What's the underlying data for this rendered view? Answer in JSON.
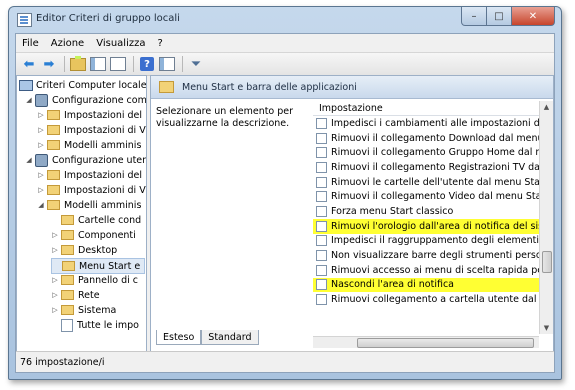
{
  "window": {
    "title": "Editor Criteri di gruppo locali",
    "minimize": "–",
    "maximize": "□",
    "close": "✕"
  },
  "menu": [
    "File",
    "Azione",
    "Visualizza",
    "?"
  ],
  "tree": [
    {
      "label": "Criteri Computer locale",
      "icon": "computer-icon",
      "level": 0,
      "toggle": ""
    },
    {
      "label": "Configurazione com",
      "icon": "config-icon",
      "level": 1,
      "toggle": "◢"
    },
    {
      "label": "Impostazioni del",
      "icon": "folder-icon",
      "level": 2,
      "toggle": "▷"
    },
    {
      "label": "Impostazioni di V",
      "icon": "folder-icon",
      "level": 2,
      "toggle": "▷"
    },
    {
      "label": "Modelli amminis",
      "icon": "folder-icon",
      "level": 2,
      "toggle": "▷"
    },
    {
      "label": "Configurazione uten",
      "icon": "config-icon",
      "level": 1,
      "toggle": "◢"
    },
    {
      "label": "Impostazioni del",
      "icon": "folder-icon",
      "level": 2,
      "toggle": "▷"
    },
    {
      "label": "Impostazioni di V",
      "icon": "folder-icon",
      "level": 2,
      "toggle": "▷"
    },
    {
      "label": "Modelli amminis",
      "icon": "folder-icon",
      "level": 2,
      "toggle": "◢"
    },
    {
      "label": "Cartelle cond",
      "icon": "folder-icon",
      "level": 3,
      "toggle": ""
    },
    {
      "label": "Componenti",
      "icon": "folder-icon",
      "level": 3,
      "toggle": "▷"
    },
    {
      "label": "Desktop",
      "icon": "folder-icon",
      "level": 3,
      "toggle": "▷"
    },
    {
      "label": "Menu Start e",
      "icon": "folder-icon",
      "level": 3,
      "toggle": "",
      "selected": true
    },
    {
      "label": "Pannello di c",
      "icon": "folder-icon",
      "level": 3,
      "toggle": "▷"
    },
    {
      "label": "Rete",
      "icon": "folder-icon",
      "level": 3,
      "toggle": "▷"
    },
    {
      "label": "Sistema",
      "icon": "folder-icon",
      "level": 3,
      "toggle": "▷"
    },
    {
      "label": "Tutte le impo",
      "icon": "policy-icon",
      "level": 3,
      "toggle": ""
    }
  ],
  "details": {
    "header": "Menu Start e barra delle applicazioni",
    "description": "Selezionare un elemento per visualizzarne la descrizione.",
    "column_header": "Impostazione",
    "items": [
      {
        "label": "Impedisci i cambiamenti alle impostazioni del menu",
        "highlighted": false
      },
      {
        "label": "Rimuovi il collegamento Download dal menu Start",
        "highlighted": false
      },
      {
        "label": "Rimuovi il collegamento Gruppo Home dal menu S",
        "highlighted": false
      },
      {
        "label": "Rimuovi il collegamento Registrazioni TV dal menu",
        "highlighted": false
      },
      {
        "label": "Rimuovi le cartelle dell'utente dal menu Start",
        "highlighted": false
      },
      {
        "label": "Rimuovi il collegamento Video dal menu Start",
        "highlighted": false
      },
      {
        "label": "Forza menu Start classico",
        "highlighted": false
      },
      {
        "label": "Rimuovi l'orologio dall'area di notifica del sistema",
        "highlighted": true
      },
      {
        "label": "Impedisci il raggruppamento degli elementi della b",
        "highlighted": false
      },
      {
        "label": "Non visualizzare barre degli strumenti personalizzat",
        "highlighted": false
      },
      {
        "label": "Rimuovi accesso ai menu di scelta rapida per la bar",
        "highlighted": false
      },
      {
        "label": "Nascondi l'area di notifica",
        "highlighted": true
      },
      {
        "label": "Rimuovi collegamento a cartella utente dal menu S",
        "highlighted": false
      }
    ],
    "tabs": [
      "Esteso",
      "Standard"
    ]
  },
  "status": "76 impostazione/i",
  "colors": {
    "highlight": "#ffff33",
    "title_bar": "#b9cfe7",
    "close_button": "#c7452c"
  }
}
